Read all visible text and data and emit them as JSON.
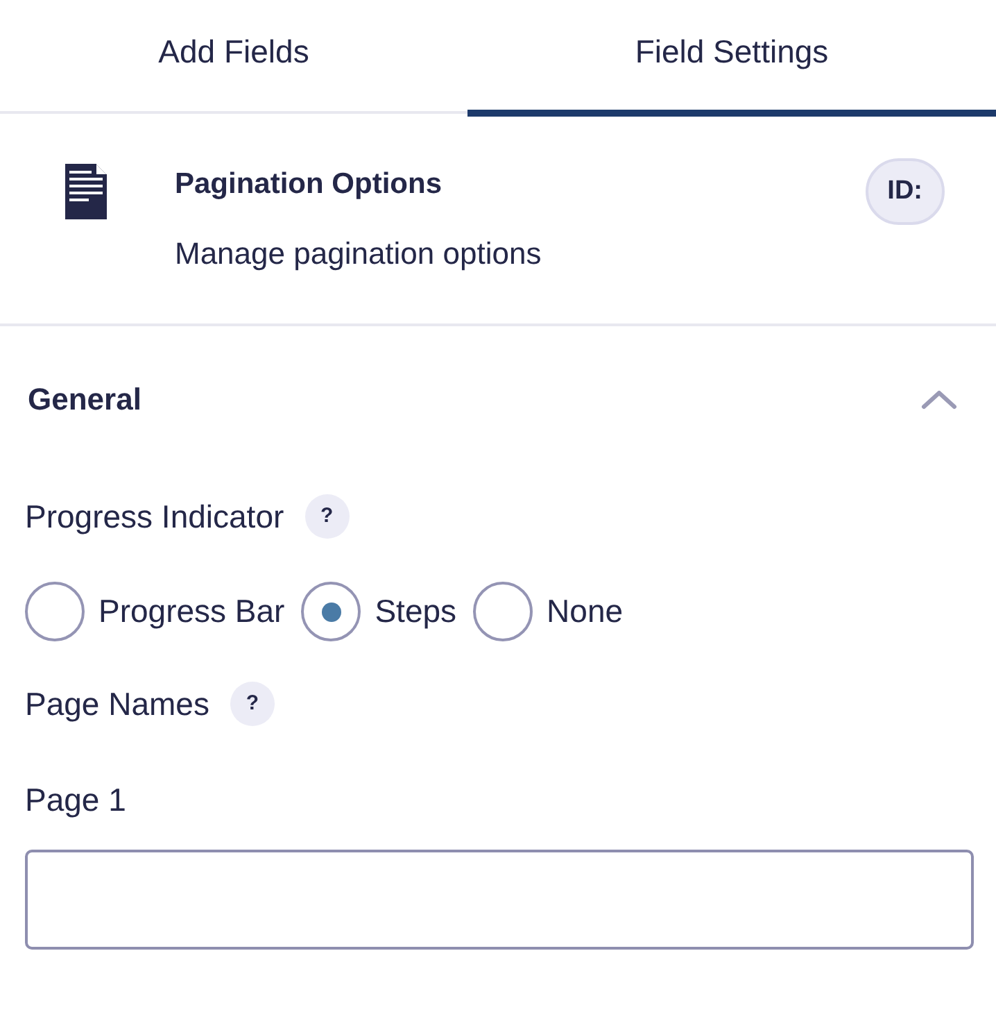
{
  "tabs": [
    {
      "label": "Add Fields",
      "selected": false
    },
    {
      "label": "Field Settings",
      "selected": true
    }
  ],
  "field": {
    "title": "Pagination Options",
    "description": "Manage pagination options",
    "id_badge": "ID:"
  },
  "section": {
    "title": "General",
    "expanded": true
  },
  "progress_indicator": {
    "label": "Progress Indicator",
    "help": "?",
    "options": [
      {
        "label": "Progress Bar",
        "selected": false
      },
      {
        "label": "Steps",
        "selected": true
      },
      {
        "label": "None",
        "selected": false
      }
    ]
  },
  "page_names": {
    "label": "Page Names",
    "help": "?",
    "pages": [
      {
        "label": "Page 1"
      }
    ]
  }
}
